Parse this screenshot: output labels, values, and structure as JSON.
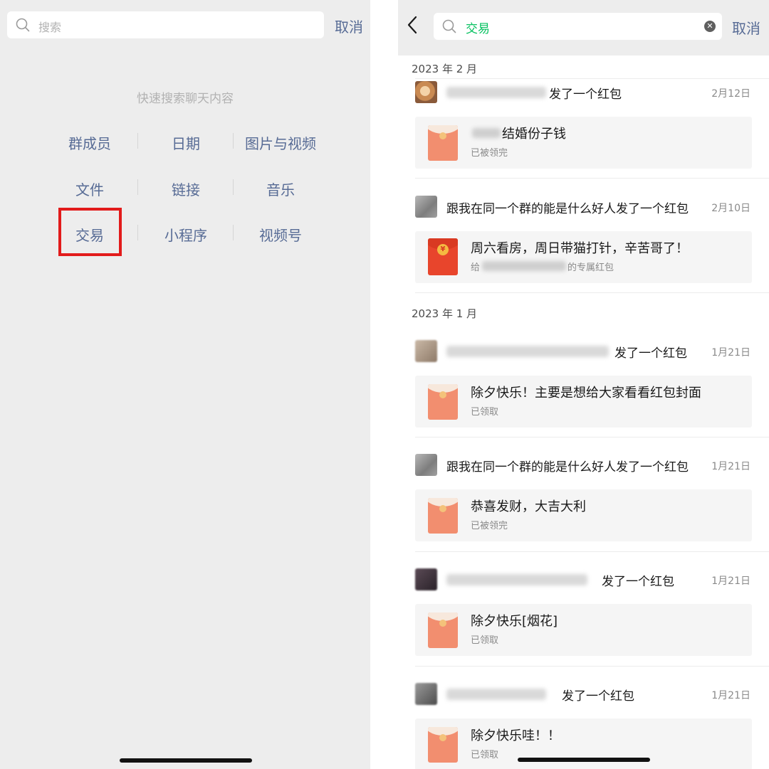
{
  "left": {
    "search_placeholder": "搜索",
    "cancel": "取消",
    "hint": "快速搜索聊天内容",
    "categories": [
      "群成员",
      "日期",
      "图片与视频",
      "文件",
      "链接",
      "音乐",
      "交易",
      "小程序",
      "视频号"
    ],
    "highlighted_category": "交易",
    "highlight_color": "#e21b1b"
  },
  "right": {
    "query": "交易",
    "cancel": "取消",
    "sections": [
      {
        "month": "2023 年 2 月",
        "items": [
          {
            "sender_suffix": "发了一个红包",
            "date": "2月12日",
            "card_title": "结婚份子钱",
            "card_status": "已被领完",
            "envelope": "pale"
          },
          {
            "sender": "跟我在同一个群的能是什么好人发了一个红包",
            "date": "2月10日",
            "card_title": "周六看房，周日带猫打针，辛苦哥了！",
            "card_status_prefix": "给",
            "card_status_suffix": "的专属红包",
            "envelope": "bright"
          }
        ]
      },
      {
        "month": "2023 年 1 月",
        "items": [
          {
            "sender_suffix": "发了一个红包",
            "date": "1月21日",
            "card_title": "除夕快乐！主要是想给大家看看红包封面",
            "card_status": "已领取",
            "envelope": "pale"
          },
          {
            "sender": "跟我在同一个群的能是什么好人发了一个红包",
            "date": "1月21日",
            "card_title": "恭喜发财，大吉大利",
            "card_status": "已被领完",
            "envelope": "pale"
          },
          {
            "sender_suffix": "发了一个红包",
            "date": "1月21日",
            "card_title": "除夕快乐[烟花]",
            "card_status": "已领取",
            "envelope": "pale"
          },
          {
            "sender_suffix": "发了一个红包",
            "date": "1月21日",
            "card_title": "除夕快乐哇！！",
            "card_status": "已领取",
            "envelope": "pale"
          }
        ]
      }
    ]
  },
  "colors": {
    "link_blue": "#576b95",
    "wechat_green": "#07c160",
    "hint_gray": "#b2b2b2"
  }
}
